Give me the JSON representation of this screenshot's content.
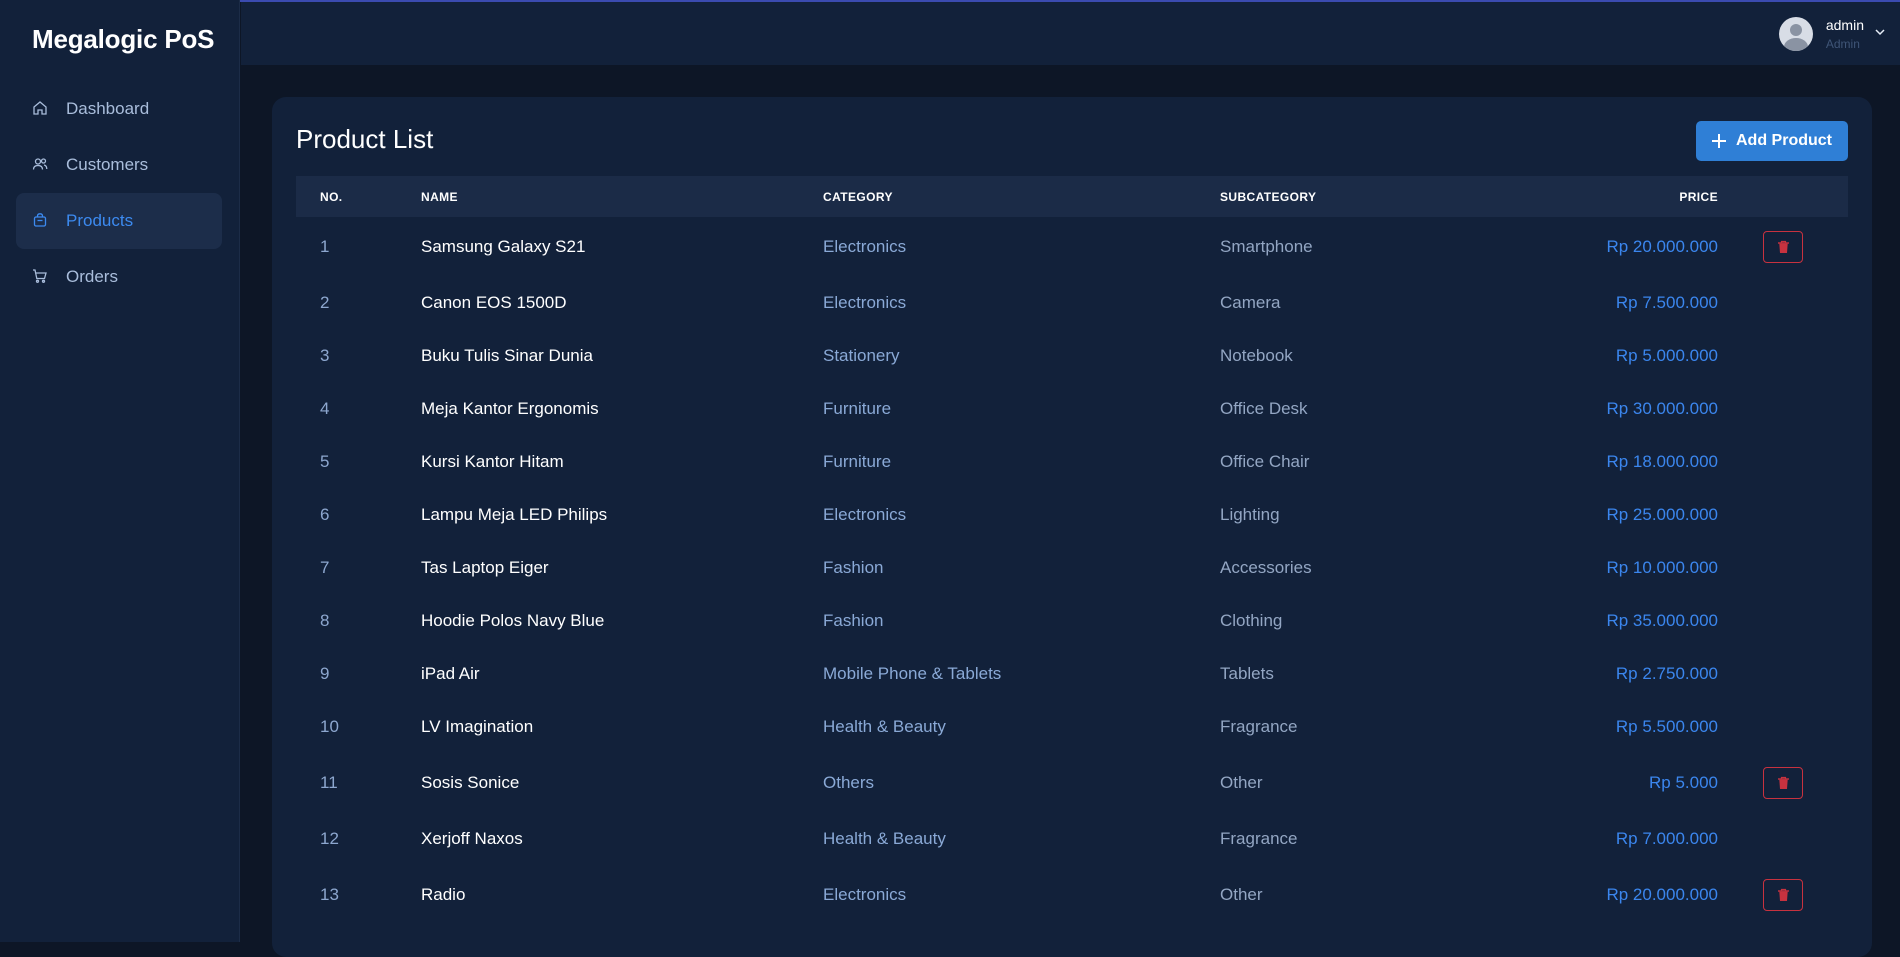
{
  "app": {
    "brand": "Megalogic PoS"
  },
  "sidebar": {
    "items": [
      {
        "label": "Dashboard",
        "icon": "home-icon",
        "active": false
      },
      {
        "label": "Customers",
        "icon": "users-icon",
        "active": false
      },
      {
        "label": "Products",
        "icon": "bag-icon",
        "active": true
      },
      {
        "label": "Orders",
        "icon": "cart-icon",
        "active": false
      }
    ]
  },
  "header": {
    "user": {
      "name": "admin",
      "role": "Admin"
    }
  },
  "main": {
    "title": "Product List",
    "add_button": "Add Product",
    "columns": {
      "no": "NO.",
      "name": "NAME",
      "category": "CATEGORY",
      "subcategory": "SUBCATEGORY",
      "price": "PRICE"
    },
    "rows": [
      {
        "no": "1",
        "name": "Samsung Galaxy S21",
        "category": "Electronics",
        "subcategory": "Smartphone",
        "price": "Rp 20.000.000",
        "delete": true
      },
      {
        "no": "2",
        "name": "Canon EOS 1500D",
        "category": "Electronics",
        "subcategory": "Camera",
        "price": "Rp 7.500.000",
        "delete": false
      },
      {
        "no": "3",
        "name": "Buku Tulis Sinar Dunia",
        "category": "Stationery",
        "subcategory": "Notebook",
        "price": "Rp 5.000.000",
        "delete": false
      },
      {
        "no": "4",
        "name": "Meja Kantor Ergonomis",
        "category": "Furniture",
        "subcategory": "Office Desk",
        "price": "Rp 30.000.000",
        "delete": false
      },
      {
        "no": "5",
        "name": "Kursi Kantor Hitam",
        "category": "Furniture",
        "subcategory": "Office Chair",
        "price": "Rp 18.000.000",
        "delete": false
      },
      {
        "no": "6",
        "name": "Lampu Meja LED Philips",
        "category": "Electronics",
        "subcategory": "Lighting",
        "price": "Rp 25.000.000",
        "delete": false
      },
      {
        "no": "7",
        "name": "Tas Laptop Eiger",
        "category": "Fashion",
        "subcategory": "Accessories",
        "price": "Rp 10.000.000",
        "delete": false
      },
      {
        "no": "8",
        "name": "Hoodie Polos Navy Blue",
        "category": "Fashion",
        "subcategory": "Clothing",
        "price": "Rp 35.000.000",
        "delete": false
      },
      {
        "no": "9",
        "name": "iPad Air",
        "category": "Mobile Phone & Tablets",
        "subcategory": "Tablets",
        "price": "Rp 2.750.000",
        "delete": false
      },
      {
        "no": "10",
        "name": "LV Imagination",
        "category": "Health & Beauty",
        "subcategory": "Fragrance",
        "price": "Rp 5.500.000",
        "delete": false
      },
      {
        "no": "11",
        "name": "Sosis Sonice",
        "category": "Others",
        "subcategory": "Other",
        "price": "Rp 5.000",
        "delete": true
      },
      {
        "no": "12",
        "name": "Xerjoff Naxos",
        "category": "Health & Beauty",
        "subcategory": "Fragrance",
        "price": "Rp 7.000.000",
        "delete": false
      },
      {
        "no": "13",
        "name": "Radio",
        "category": "Electronics",
        "subcategory": "Other",
        "price": "Rp 20.000.000",
        "delete": true
      }
    ]
  },
  "colors": {
    "accent": "#2f7fd6",
    "danger": "#c7323f",
    "background": "#0d1626",
    "panel": "#12213a"
  }
}
